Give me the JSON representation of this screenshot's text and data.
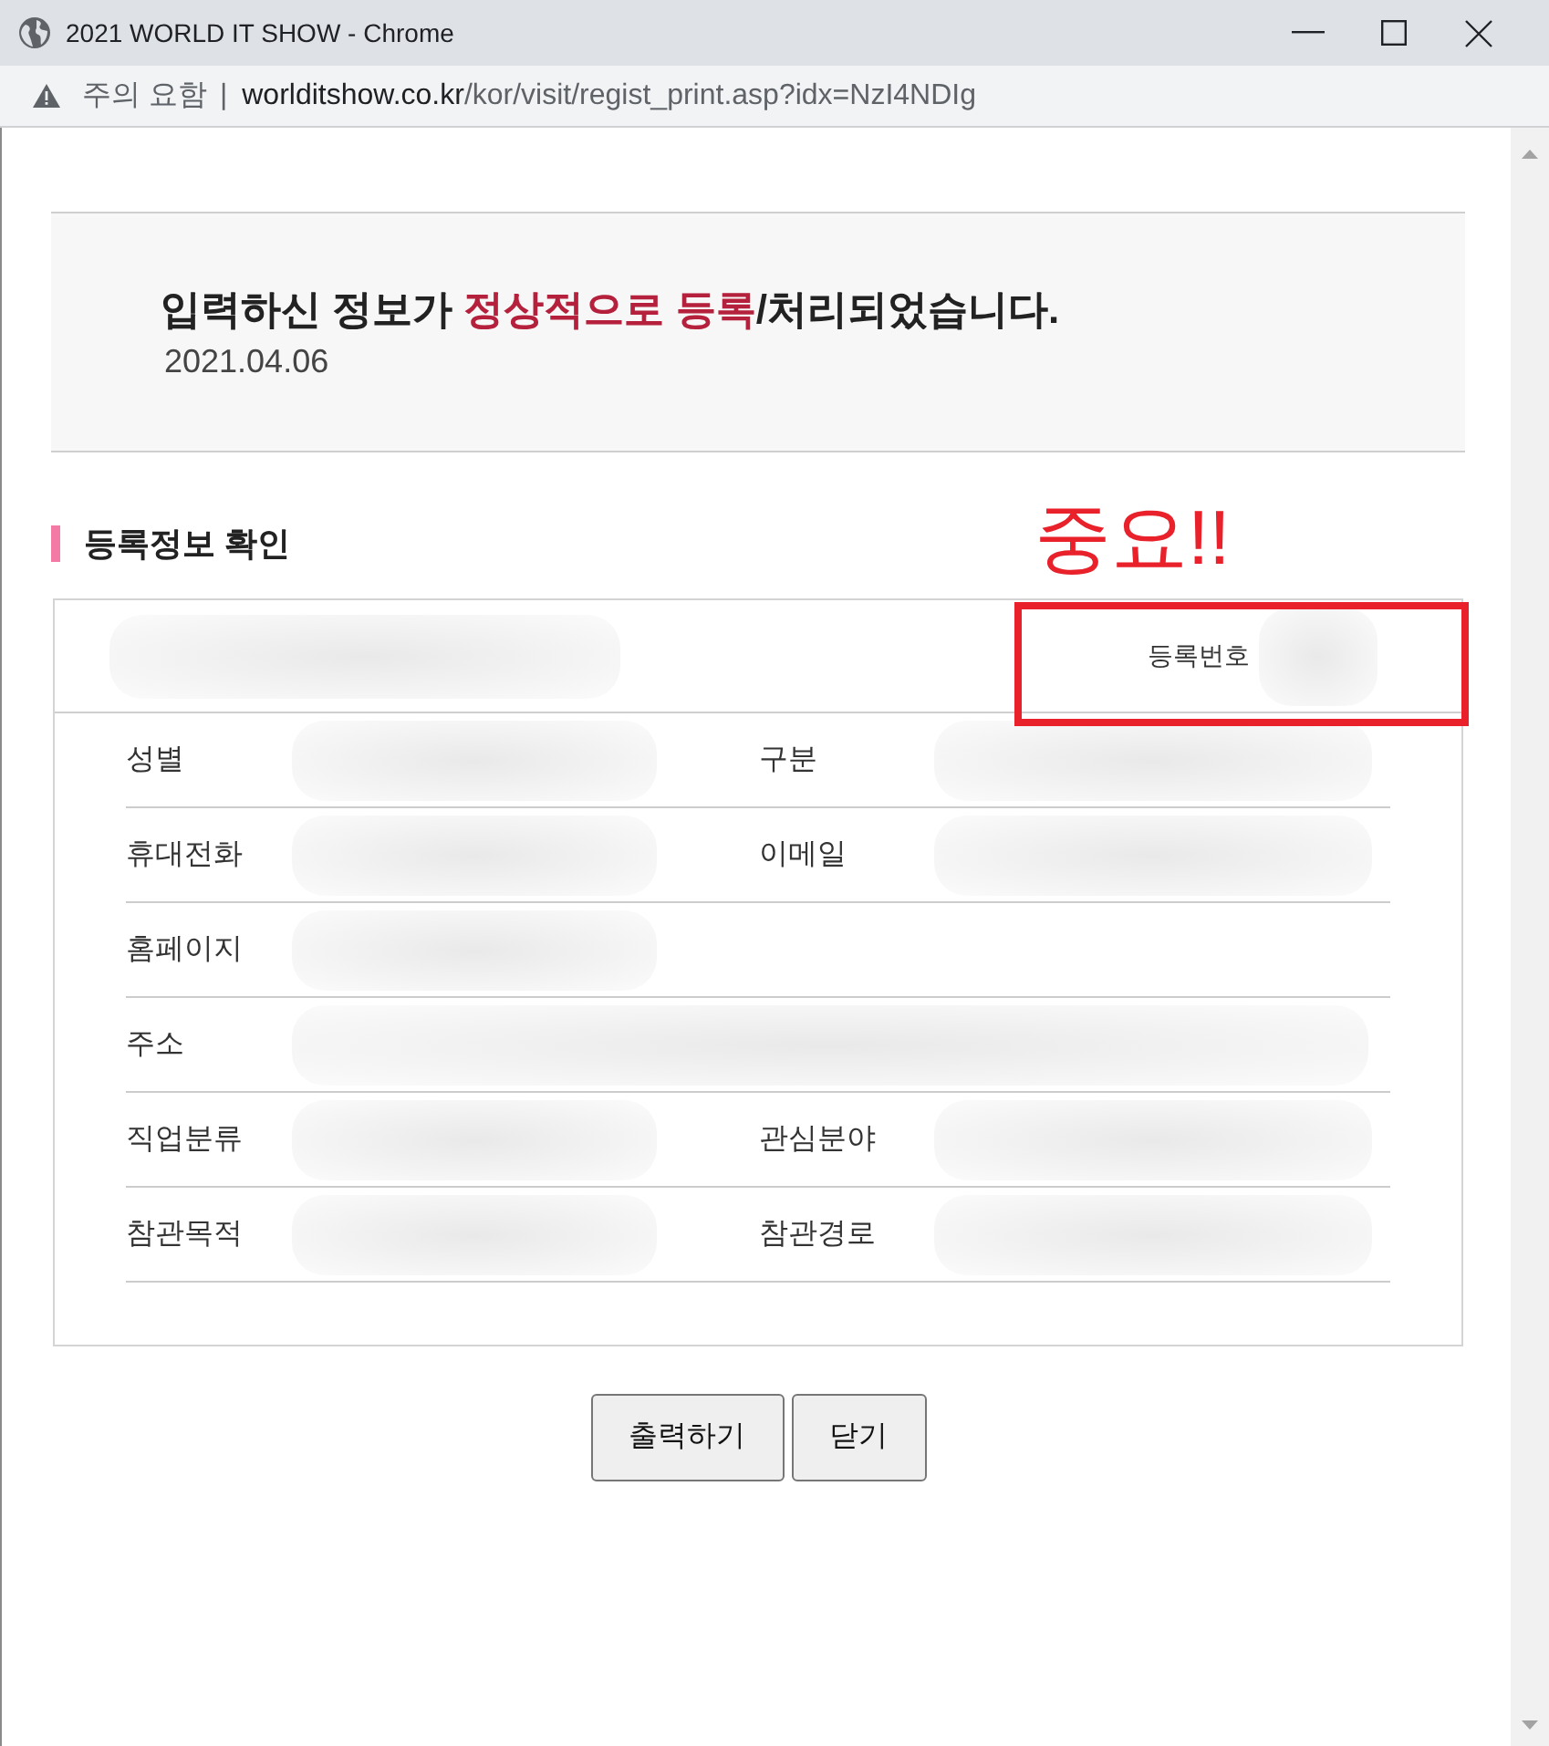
{
  "window": {
    "title": "2021 WORLD IT SHOW - Chrome"
  },
  "address_bar": {
    "security_label": "주의 요함",
    "separator": "|",
    "url_host": "worlditshow.co.kr",
    "url_path": "/kor/visit/regist_print.asp?idx=NzI4NDIg"
  },
  "notice": {
    "message": [
      {
        "text": "입력하신 정보가 ",
        "highlight": false
      },
      {
        "text": "정상적으로 등록",
        "highlight": true
      },
      {
        "text": "/처리되었습니다.",
        "highlight": false
      }
    ],
    "date": "2021.04.06"
  },
  "section": {
    "title": "등록정보 확인"
  },
  "annotation": {
    "text": "중요!!"
  },
  "registration_number": {
    "label": "등록번호"
  },
  "fields": [
    {
      "kind": "pair",
      "labels": [
        "성별",
        "구분"
      ]
    },
    {
      "kind": "pair",
      "labels": [
        "휴대전화",
        "이메일"
      ]
    },
    {
      "kind": "single",
      "labels": [
        "홈페이지"
      ]
    },
    {
      "kind": "wide",
      "labels": [
        "주소"
      ]
    },
    {
      "kind": "pair",
      "labels": [
        "직업분류",
        "관심분야"
      ]
    },
    {
      "kind": "pair",
      "labels": [
        "참관목적",
        "참관경로"
      ]
    }
  ],
  "buttons": [
    "출력하기",
    "닫기"
  ]
}
